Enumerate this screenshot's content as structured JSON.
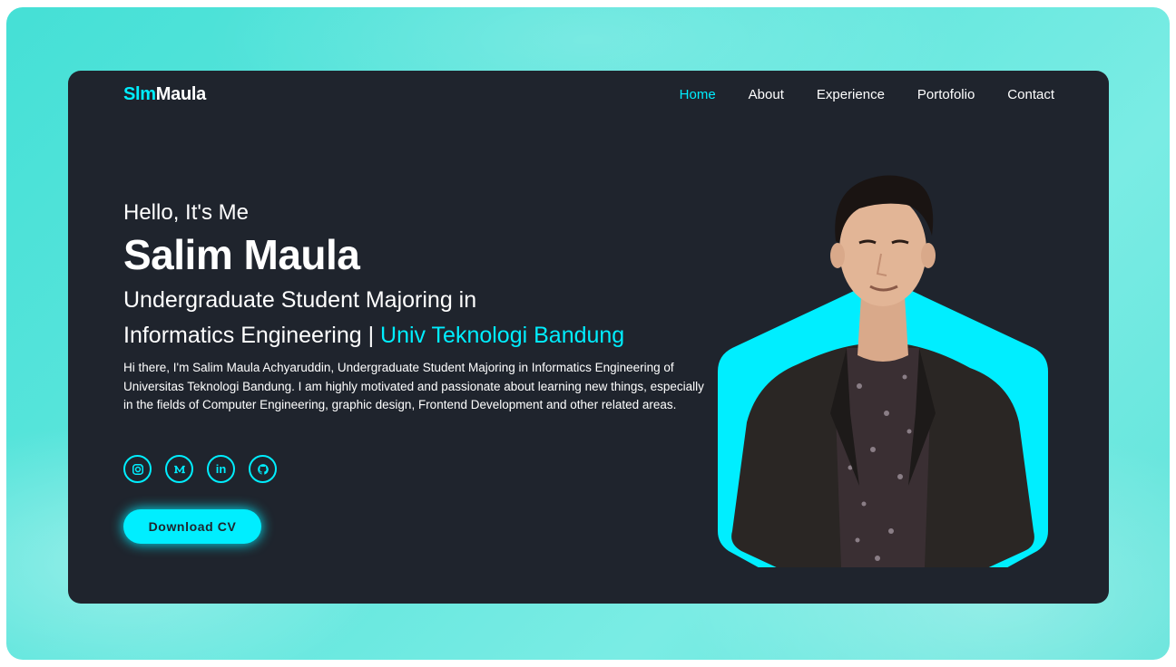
{
  "brand": {
    "prefix": "Slm",
    "suffix": "Maula"
  },
  "nav": {
    "items": [
      {
        "label": "Home",
        "active": true
      },
      {
        "label": "About",
        "active": false
      },
      {
        "label": "Experience",
        "active": false
      },
      {
        "label": "Portofolio",
        "active": false
      },
      {
        "label": "Contact",
        "active": false
      }
    ]
  },
  "hero": {
    "greeting": "Hello, It's Me",
    "name": "Salim Maula",
    "role_line1": "Undergraduate Student Majoring in",
    "role_line2": "Informatics Engineering | ",
    "role_highlight": "Univ Teknologi Bandung",
    "description": "Hi there, I'm Salim Maula Achyaruddin, Undergraduate Student Majoring in Informatics Engineering of Universitas Teknologi Bandung. I am highly motivated and passionate about learning new things, especially in the fields of Computer Engineering, graphic design, Frontend Development and other related areas.",
    "cta_label": "Download CV"
  },
  "socials": [
    {
      "icon": "instagram-icon"
    },
    {
      "icon": "medium-icon"
    },
    {
      "icon": "linkedin-icon"
    },
    {
      "icon": "github-icon"
    }
  ],
  "colors": {
    "accent": "#00eeff",
    "card_bg": "#1f242d",
    "page_bg": "#5fe6dd"
  }
}
